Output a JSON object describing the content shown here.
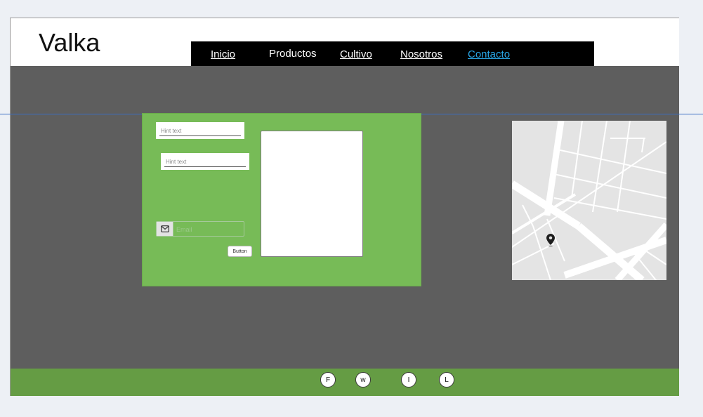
{
  "header": {
    "logo": "Valka"
  },
  "nav": {
    "items": [
      {
        "label": "Inicio"
      },
      {
        "label": "Productos"
      },
      {
        "label": "Cultivo"
      },
      {
        "label": "Nosotros"
      },
      {
        "label": "Contacto"
      }
    ],
    "active_color": "#29a6e6"
  },
  "form": {
    "field1_placeholder": "Hint text",
    "field2_placeholder": "Hint text",
    "email_placeholder": "Email",
    "button_label": "Button",
    "panel_color": "#77bb57"
  },
  "map": {
    "icon": "map-pin-icon"
  },
  "footer": {
    "social": [
      {
        "label": "F"
      },
      {
        "label": "w"
      },
      {
        "label": "I"
      },
      {
        "label": "L"
      }
    ],
    "color": "#659c44"
  }
}
